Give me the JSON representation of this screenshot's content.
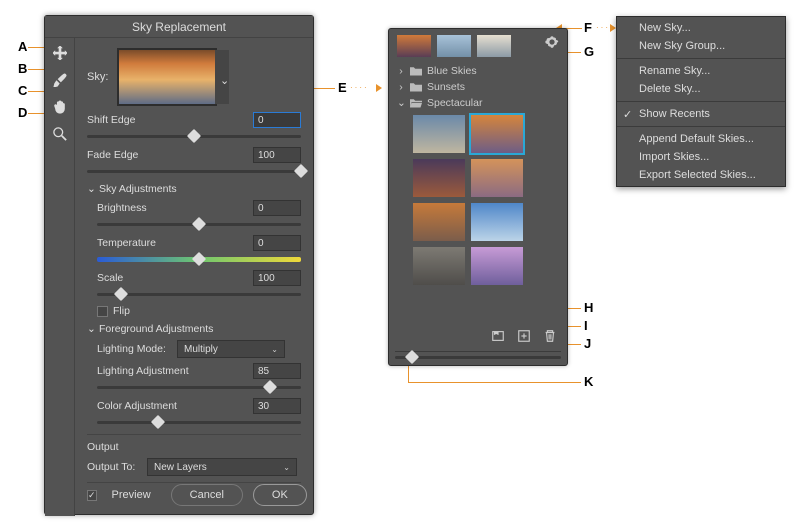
{
  "dialog": {
    "title": "Sky Replacement",
    "sky_label": "Sky:",
    "shift_edge_label": "Shift Edge",
    "shift_edge_value": "0",
    "fade_edge_label": "Fade Edge",
    "fade_edge_value": "100",
    "sky_adjustments_header": "Sky Adjustments",
    "brightness_label": "Brightness",
    "brightness_value": "0",
    "temperature_label": "Temperature",
    "temperature_value": "0",
    "scale_label": "Scale",
    "scale_value": "100",
    "flip_label": "Flip",
    "fg_adjustments_header": "Foreground Adjustments",
    "lighting_mode_label": "Lighting Mode:",
    "lighting_mode_value": "Multiply",
    "lighting_adjustment_label": "Lighting Adjustment",
    "lighting_adjustment_value": "85",
    "color_adjustment_label": "Color Adjustment",
    "color_adjustment_value": "30",
    "output_header": "Output",
    "output_to_label": "Output To:",
    "output_to_value": "New Layers",
    "preview_label": "Preview",
    "cancel_label": "Cancel",
    "ok_label": "OK"
  },
  "preset": {
    "folders": [
      {
        "name": "Blue Skies",
        "open": false
      },
      {
        "name": "Sunsets",
        "open": false
      },
      {
        "name": "Spectacular",
        "open": true
      }
    ]
  },
  "menu": {
    "items": [
      {
        "label": "New Sky...",
        "sep": false
      },
      {
        "label": "New Sky Group...",
        "sep": true
      },
      {
        "label": "Rename Sky...",
        "sep": false
      },
      {
        "label": "Delete Sky...",
        "sep": true
      },
      {
        "label": "Show Recents",
        "check": true,
        "sep": true
      },
      {
        "label": "Append Default Skies...",
        "sep": false
      },
      {
        "label": "Import Skies...",
        "sep": false
      },
      {
        "label": "Export Selected Skies...",
        "sep": false
      }
    ]
  },
  "callouts": {
    "A": "A",
    "B": "B",
    "C": "C",
    "D": "D",
    "E": "E",
    "F": "F",
    "G": "G",
    "H": "H",
    "I": "I",
    "J": "J",
    "K": "K"
  }
}
